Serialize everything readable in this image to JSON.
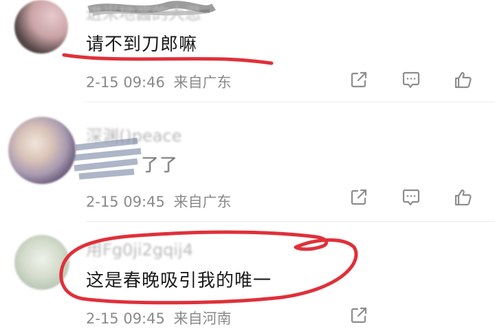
{
  "comments": [
    {
      "username": "进米地酱的大忌",
      "text": "请不到刀郎嘛",
      "date": "2-15 09:46",
      "location": "来自广东"
    },
    {
      "username": "深渊()peace",
      "text": "了了",
      "date": "2-15 09:45",
      "location": "来自广东"
    },
    {
      "username": "用Fg0ji2gqij4",
      "text": "这是春晚吸引我的唯一",
      "date": "2-15 09:45",
      "location": "来自河南"
    }
  ],
  "icons": {
    "share": "share-icon",
    "comment": "comment-icon",
    "like": "thumbs-up-icon"
  },
  "colors": {
    "annotation": "#e0303a",
    "meta_text": "#8a8a8a",
    "body_text": "#1a1a1a"
  }
}
